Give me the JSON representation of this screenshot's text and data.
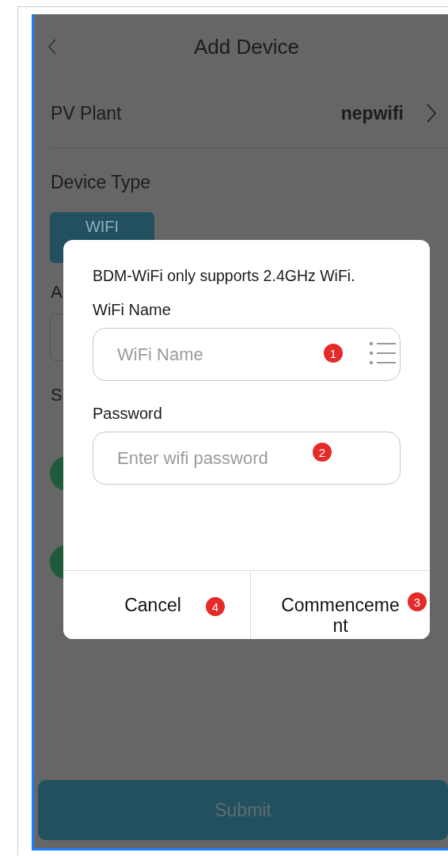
{
  "header": {
    "title": "Add Device"
  },
  "pv_plant": {
    "label": "PV Plant",
    "value": "nepwifi"
  },
  "device_type": {
    "label": "Device Type",
    "options": [
      {
        "label": "WIFI",
        "selected": true
      }
    ]
  },
  "partial_labels": [
    "A",
    "S"
  ],
  "dialog": {
    "notice": "BDM-WiFi only supports 2.4GHz WiFi.",
    "fields": [
      {
        "label": "WiFi Name",
        "placeholder": "WiFi Name",
        "badge": "1",
        "kind": "list"
      },
      {
        "label": "Password",
        "placeholder": "Enter wifi password",
        "badge": "2",
        "kind": "password"
      }
    ],
    "buttons": [
      {
        "label": "Cancel",
        "badge": "4"
      },
      {
        "label": "Commencement",
        "badge": "3"
      }
    ]
  },
  "submit": {
    "label": "Submit"
  }
}
